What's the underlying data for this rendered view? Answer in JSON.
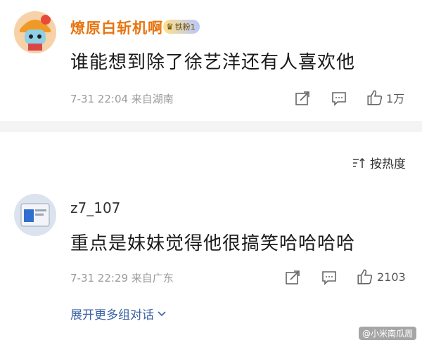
{
  "comments": [
    {
      "username": "燎原白斩机啊",
      "badge": "铁粉1",
      "text": "谁能想到除了徐艺洋还有人喜欢他",
      "meta": "7-31 22:04 来自湖南",
      "likes": "1万"
    },
    {
      "username": "z7_107",
      "text": "重点是妹妹觉得他很搞笑哈哈哈哈",
      "meta": "7-31 22:29 来自广东",
      "likes": "2103"
    }
  ],
  "sort_label": "按热度",
  "expand_label": "展开更多组对话",
  "watermark": "@小米南瓜周",
  "colors": {
    "username_accent": "#e8740f",
    "expand_link": "#3b62a6"
  },
  "icons": [
    "share-icon",
    "comment-icon",
    "like-icon",
    "sort-icon",
    "chevron-down-icon"
  ]
}
